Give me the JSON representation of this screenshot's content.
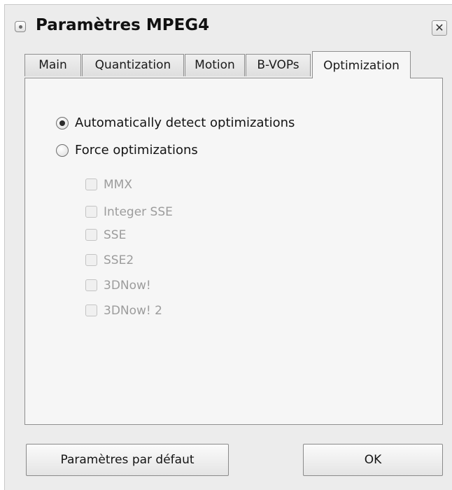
{
  "window": {
    "title": "Paramètres MPEG4",
    "close_glyph": "✕"
  },
  "tabs": [
    {
      "label": "Main",
      "active": false
    },
    {
      "label": "Quantization",
      "active": false
    },
    {
      "label": "Motion",
      "active": false
    },
    {
      "label": "B-VOPs",
      "active": false
    },
    {
      "label": "Optimization",
      "active": true
    }
  ],
  "optimization": {
    "radios": [
      {
        "label": "Automatically detect optimizations",
        "checked": true
      },
      {
        "label": "Force optimizations",
        "checked": false
      }
    ],
    "checkboxes": [
      {
        "label": "MMX",
        "checked": false,
        "enabled": false
      },
      {
        "label": "Integer SSE",
        "checked": false,
        "enabled": false
      },
      {
        "label": "SSE",
        "checked": false,
        "enabled": false
      },
      {
        "label": "SSE2",
        "checked": false,
        "enabled": false
      },
      {
        "label": "3DNow!",
        "checked": false,
        "enabled": false
      },
      {
        "label": "3DNow! 2",
        "checked": false,
        "enabled": false
      }
    ]
  },
  "buttons": {
    "defaults_label": "Paramètres par défaut",
    "ok_label": "OK"
  },
  "colors": {
    "window_bg": "#ececec",
    "panel_bg": "#f6f6f6",
    "disabled_text": "#9c9c9c"
  },
  "icons": {
    "system_menu": "window-menu-icon",
    "close": "close-icon"
  }
}
